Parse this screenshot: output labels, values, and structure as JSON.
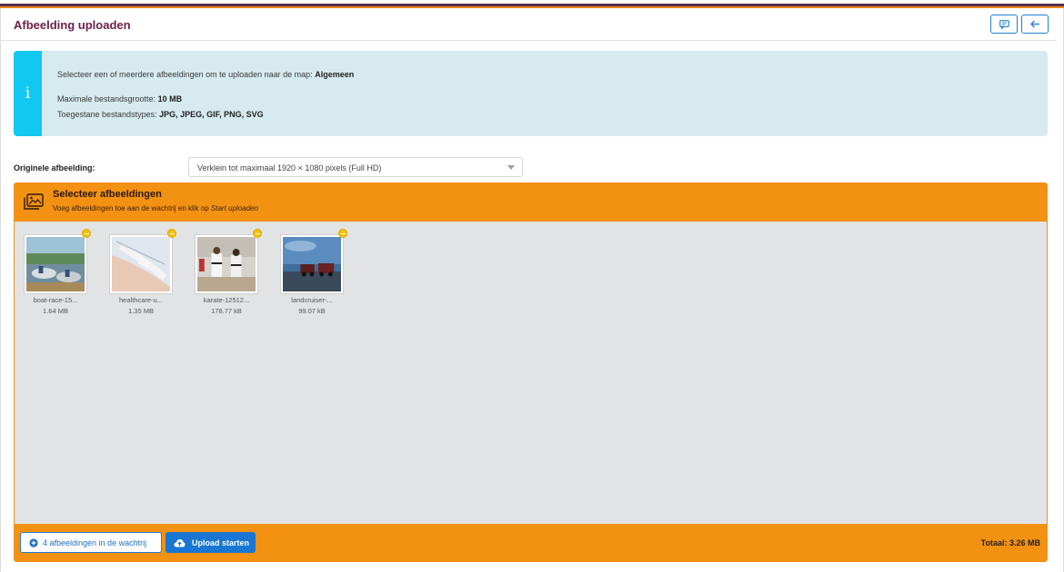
{
  "page": {
    "title": "Afbeelding uploaden",
    "header_buttons": [
      {
        "icon": "comment-icon"
      },
      {
        "icon": "arrow-left-icon"
      }
    ]
  },
  "info": {
    "icon": "i",
    "line1_text": "Selecteer een of meerdere afbeeldingen om te uploaden naar de map: ",
    "line1_folder": "Algemeen",
    "max_size_label": "Maximale bestandsgrootte: ",
    "max_size_value": "10 MB",
    "types_label": "Toegestane bestandstypes: ",
    "types_value": "JPG, JPEG, GIF, PNG, SVG"
  },
  "original": {
    "label": "Originele afbeelding:",
    "selected": "Verklein tot maximaal 1920 × 1080 pixels (Full HD)"
  },
  "uploader": {
    "title": "Selecteer afbeeldingen",
    "subtitle_prefix": "Voeg afbeeldingen toe aan de wachtrij en klik op ",
    "subtitle_action": "Start uploaden",
    "files": [
      {
        "name": "boat-race-15...",
        "size": "1.64 MB"
      },
      {
        "name": "healthcare-u...",
        "size": "1.35 MB"
      },
      {
        "name": "karate-12512...",
        "size": "178.77 kB"
      },
      {
        "name": "landcruiser-...",
        "size": "99.07 kB"
      }
    ],
    "queue_button": "4 afbeeldingen in de wachtrij",
    "start_button": "Upload starten",
    "total": "Totaal: 3.26 MB"
  },
  "colors": {
    "accent_orange": "#f39113",
    "primary_blue": "#1976d2",
    "info_bg": "#d6eaf0",
    "info_bar": "#12c8f0",
    "title_color": "#6b2148"
  }
}
